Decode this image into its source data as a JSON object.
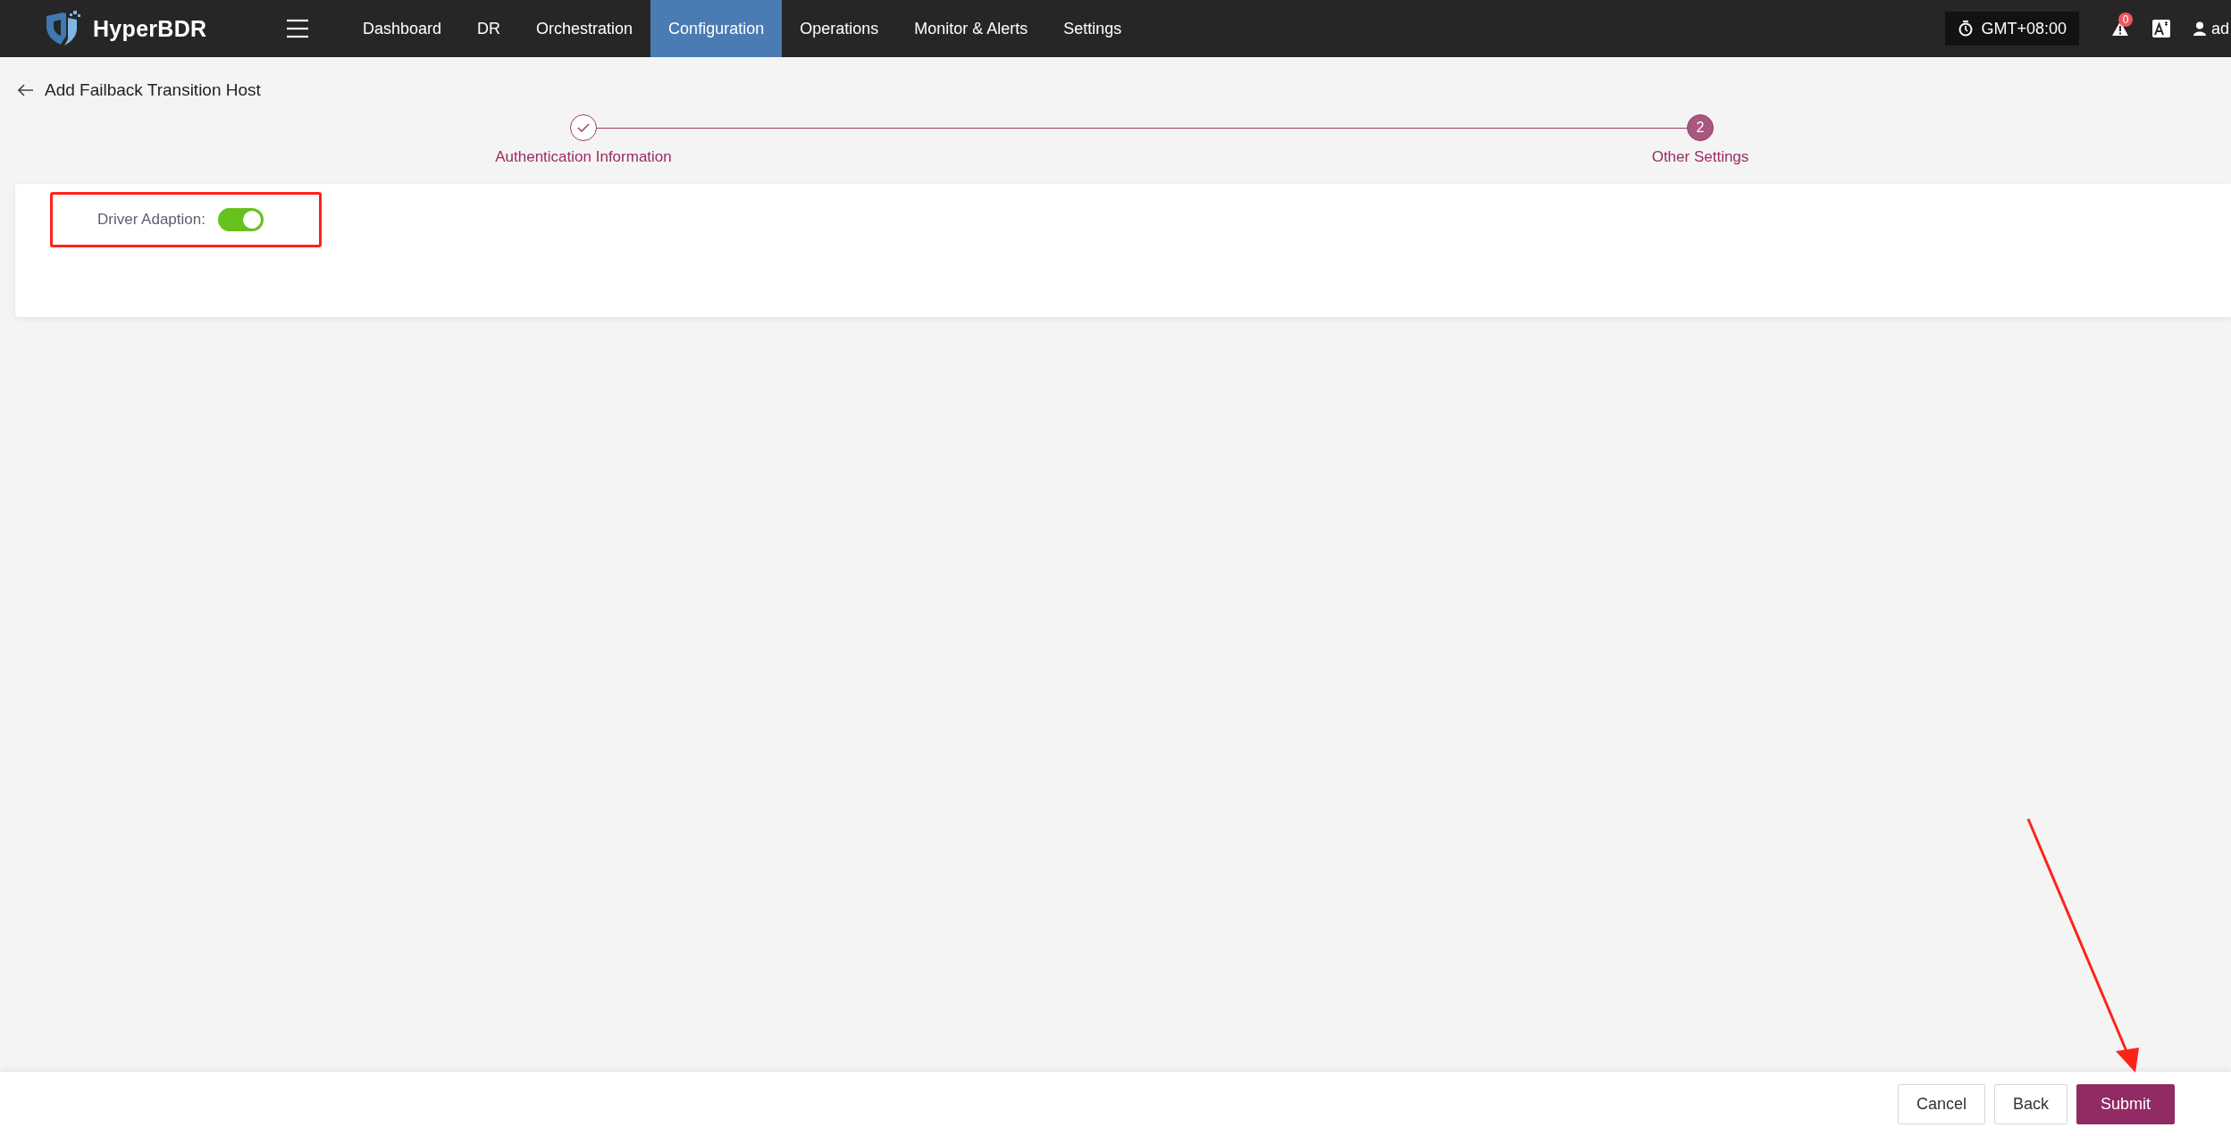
{
  "topbar": {
    "brand": "HyperBDR",
    "nav": [
      {
        "label": "Dashboard",
        "selected": false
      },
      {
        "label": "DR",
        "selected": false
      },
      {
        "label": "Orchestration",
        "selected": false
      },
      {
        "label": "Configuration",
        "selected": true
      },
      {
        "label": "Operations",
        "selected": false
      },
      {
        "label": "Monitor & Alerts",
        "selected": false
      },
      {
        "label": "Settings",
        "selected": false
      }
    ],
    "timezone": "GMT+08:00",
    "alert_count": "0",
    "user": "ad"
  },
  "page": {
    "title": "Add Failback Transition Host"
  },
  "steps": [
    {
      "label": "Authentication Information",
      "completed": true
    },
    {
      "label": "Other Settings",
      "completed": false,
      "number": "2"
    }
  ],
  "driver_adaption": {
    "label": "Driver Adaption:",
    "on": true
  },
  "footer": {
    "buttons": [
      {
        "label": "Cancel",
        "kind": "default"
      },
      {
        "label": "Back",
        "kind": "default"
      },
      {
        "label": "Submit",
        "kind": "primary"
      }
    ]
  }
}
